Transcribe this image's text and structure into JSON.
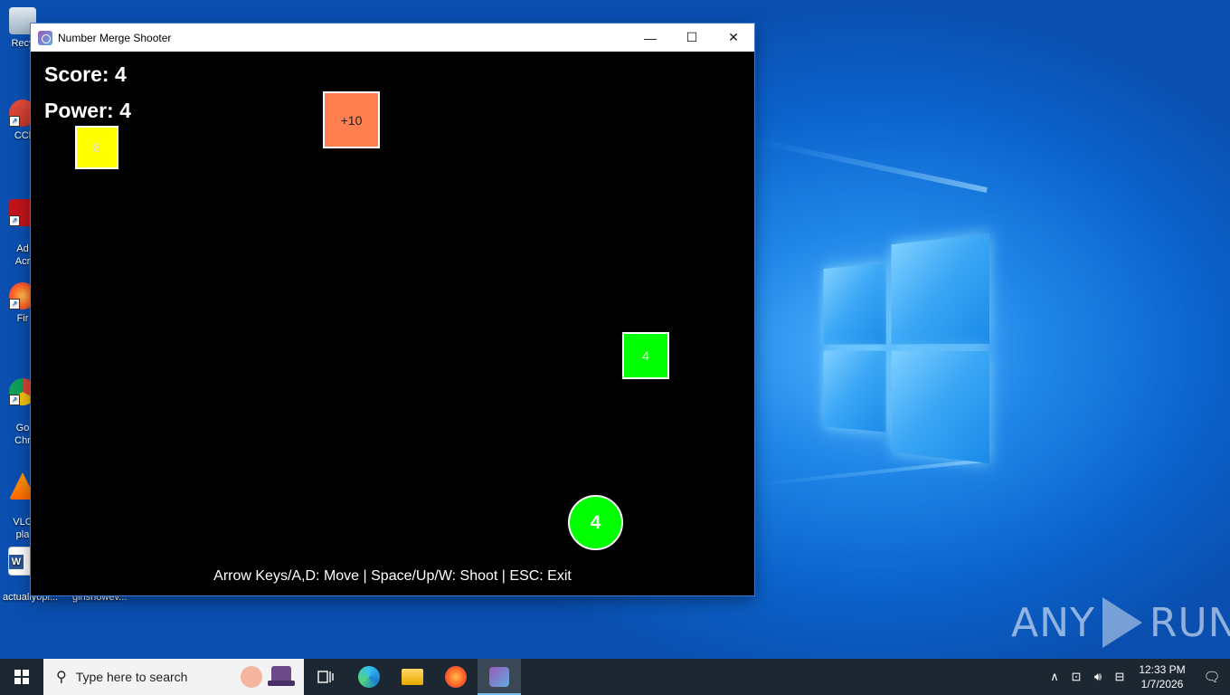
{
  "desktop": {
    "icons": [
      {
        "name": "recycle-bin",
        "label": "Recy"
      },
      {
        "name": "ccleaner",
        "label": "CCl"
      },
      {
        "name": "adobe-acrobat",
        "label": "Ad\nAcr"
      },
      {
        "name": "firefox",
        "label": "Fir"
      },
      {
        "name": "google-chrome",
        "label": "Go\nChr"
      },
      {
        "name": "vlc",
        "label": "VLC\npla"
      },
      {
        "name": "word-doc",
        "label": "actuallyopi..."
      }
    ],
    "extra_label": "girlshowev...",
    "watermark": {
      "left": "ANY",
      "right": "RUN"
    }
  },
  "window": {
    "title": "Number Merge Shooter",
    "controls": {
      "minimize": "—",
      "maximize": "☐",
      "close": "✕"
    }
  },
  "game": {
    "score_text": "Score: 4",
    "power_text": "Power: 4",
    "blocks": [
      {
        "label": "8",
        "color": "#ffff00",
        "text_color": "#dddddd"
      },
      {
        "label": "+10",
        "color": "#ff7f50",
        "text_color": "#222222"
      },
      {
        "label": "4",
        "color": "#00ff00",
        "text_color": "#ffffff"
      }
    ],
    "player": {
      "label": "4",
      "color": "#00ff00"
    },
    "instructions": "Arrow Keys/A,D: Move | Space/Up/W: Shoot | ESC: Exit"
  },
  "taskbar": {
    "search_placeholder": "Type here to search",
    "clock_time": "12:33 PM",
    "clock_date": "1/7/2026"
  }
}
